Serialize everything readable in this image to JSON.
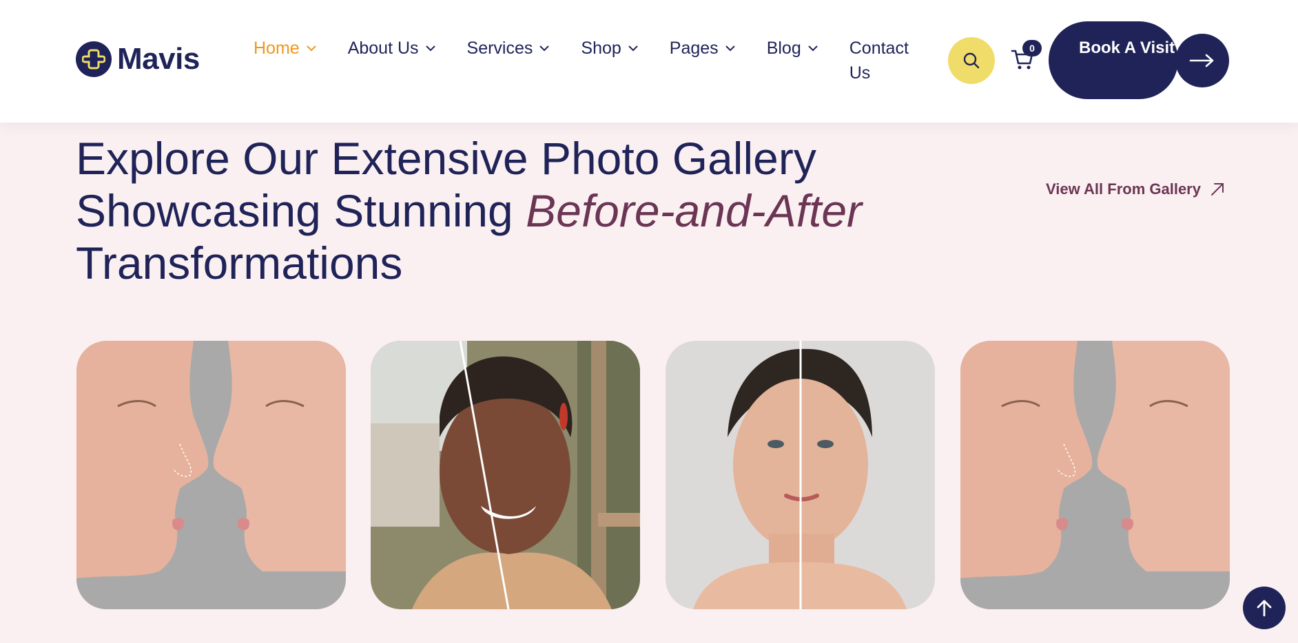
{
  "brand": {
    "name": "Mavis",
    "logo_icon": "cross-plus-logo-icon"
  },
  "nav": {
    "items": [
      {
        "label": "Home",
        "active": true
      },
      {
        "label": "About Us",
        "active": false
      },
      {
        "label": "Services",
        "active": false
      },
      {
        "label": "Shop",
        "active": false
      },
      {
        "label": "Pages",
        "active": false
      },
      {
        "label": "Blog",
        "active": false
      }
    ],
    "contact_label": "Contact Us"
  },
  "header_actions": {
    "search_icon": "search-icon",
    "cart_count": "0",
    "book_label": "Book A Visit"
  },
  "section": {
    "headline_part1": "Explore Our Extensive Photo Gallery Showcasing Stunning ",
    "headline_accent": "Before-and-After",
    "headline_part2": " Transformations",
    "view_all_label": "View All From Gallery"
  },
  "gallery": [
    {
      "alt": "Nose profile before and after"
    },
    {
      "alt": "Skin tone before and after"
    },
    {
      "alt": "Face aging before and after"
    },
    {
      "alt": "Nose profile before and after"
    }
  ],
  "colors": {
    "navy": "#1f2358",
    "accent_orange": "#f2961b",
    "accent_plum": "#6b3554",
    "search_yellow": "#f0dc68",
    "page_bg": "#fbf0f1"
  }
}
